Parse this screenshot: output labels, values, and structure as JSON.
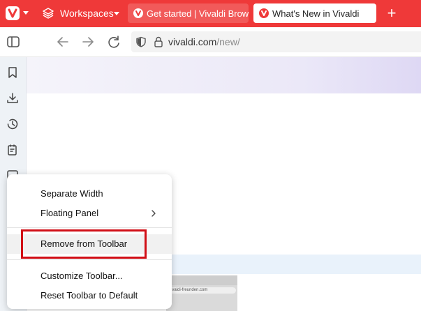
{
  "tabbar": {
    "workspaces_label": "Workspaces",
    "tabs": [
      {
        "title": "Get started | Vivaldi Browse",
        "active": false
      },
      {
        "title": "What's New in Vivaldi",
        "active": true
      }
    ],
    "new_tab_symbol": "+"
  },
  "addressbar": {
    "url_host": "vivaldi.com",
    "url_path": "/new/"
  },
  "sidepanel": {
    "icons": [
      "bookmarks-icon",
      "downloads-icon",
      "history-icon",
      "notes-icon",
      "translate-icon"
    ]
  },
  "context_menu": {
    "items": [
      {
        "label": "Separate Width",
        "has_submenu": false
      },
      {
        "label": "Floating Panel",
        "has_submenu": true
      },
      {
        "label": "Remove from Toolbar",
        "has_submenu": false,
        "highlighted": true
      },
      {
        "label": "Customize Toolbar...",
        "has_submenu": false
      },
      {
        "label": "Reset Toolbar to Default",
        "has_submenu": false
      }
    ]
  },
  "thumbnail": {
    "url_text": "vivaldi-freunden.com"
  },
  "colors": {
    "accent": "#ef3939",
    "highlight_box": "#d10e16"
  }
}
